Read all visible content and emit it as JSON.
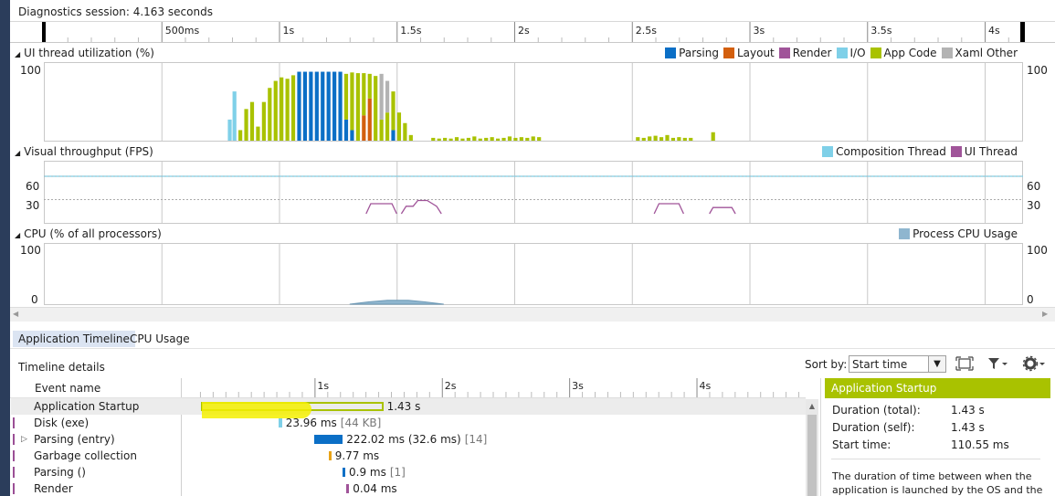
{
  "session": {
    "title": "Diagnostics session: 4.163 seconds"
  },
  "ruler": {
    "ticks": [
      "500ms",
      "1s",
      "1.5s",
      "2s",
      "2.5s",
      "3s",
      "3.5s",
      "4s"
    ]
  },
  "ui_thread": {
    "title": "UI thread utilization (%)",
    "y_label_top": "100",
    "legend": [
      {
        "label": "Parsing",
        "color": "#0b6fc6"
      },
      {
        "label": "Layout",
        "color": "#d35f0e"
      },
      {
        "label": "Render",
        "color": "#a05499"
      },
      {
        "label": "I/O",
        "color": "#7fd0e8"
      },
      {
        "label": "App Code",
        "color": "#a9c200"
      },
      {
        "label": "Xaml Other",
        "color": "#b3b3b3"
      }
    ]
  },
  "fps": {
    "title": "Visual throughput (FPS)",
    "y_labels": [
      "60",
      "30"
    ],
    "legend": [
      {
        "label": "Composition Thread",
        "color": "#7fd0e8"
      },
      {
        "label": "UI Thread",
        "color": "#a05499"
      }
    ]
  },
  "cpu": {
    "title": "CPU (% of all processors)",
    "y_labels": [
      "100",
      "0"
    ],
    "legend": [
      {
        "label": "Process CPU Usage",
        "color": "#8fb6cf"
      }
    ]
  },
  "tabs": [
    {
      "label": "Application Timeline",
      "active": true
    },
    {
      "label": "CPU Usage",
      "active": false
    }
  ],
  "details": {
    "title": "Timeline details",
    "sort_label": "Sort by:",
    "sort_value": "Start time",
    "col_event": "Event name",
    "ticks": [
      "1s",
      "2s",
      "3s",
      "4s"
    ],
    "events": [
      {
        "name": "Application Startup",
        "expandable": false,
        "duration": "1.43 s",
        "extra": "",
        "color": "#a9c200"
      },
      {
        "name": "Disk (exe)",
        "expandable": false,
        "duration": "23.96 ms",
        "extra": "[44 KB]",
        "color": "#7fd0e8"
      },
      {
        "name": "Parsing (entry)",
        "expandable": true,
        "duration": "222.02 ms (32.6 ms)",
        "extra": "[14]",
        "color": "#0b6fc6"
      },
      {
        "name": "Garbage collection",
        "expandable": false,
        "duration": "9.77 ms",
        "extra": "",
        "color": "#e8a317"
      },
      {
        "name": "Parsing ()",
        "expandable": false,
        "duration": "0.9 ms",
        "extra": "[1]",
        "color": "#0b6fc6"
      },
      {
        "name": "Render",
        "expandable": false,
        "duration": "0.04 ms",
        "extra": "",
        "color": "#a05499"
      }
    ]
  },
  "props": {
    "title": "Application Startup",
    "rows": [
      {
        "key": "Duration (total):",
        "value": "1.43 s"
      },
      {
        "key": "Duration (self):",
        "value": "1.43 s"
      },
      {
        "key": "Start time:",
        "value": "110.55 ms"
      }
    ],
    "description": "The duration of time between when the application is launched by the OS and the"
  },
  "chart_data": [
    {
      "type": "bar",
      "title": "UI thread utilization (%)",
      "x_unit": "s",
      "ylim": [
        0,
        100
      ],
      "legend_placement": "top-right",
      "series_order": [
        "Parsing",
        "Layout",
        "Render",
        "I/O",
        "App Code",
        "Xaml Other"
      ],
      "bars": [
        {
          "t": 0.79,
          "s": {
            "I/O": 30
          }
        },
        {
          "t": 0.81,
          "s": {
            "I/O": 70
          }
        },
        {
          "t": 0.835,
          "s": {
            "App Code": 15
          }
        },
        {
          "t": 0.86,
          "s": {
            "App Code": 45
          }
        },
        {
          "t": 0.885,
          "s": {
            "App Code": 55
          }
        },
        {
          "t": 0.91,
          "s": {
            "App Code": 20
          }
        },
        {
          "t": 0.935,
          "s": {
            "App Code": 55
          }
        },
        {
          "t": 0.96,
          "s": {
            "App Code": 75
          }
        },
        {
          "t": 0.985,
          "s": {
            "App Code": 85
          }
        },
        {
          "t": 1.01,
          "s": {
            "App Code": 90
          }
        },
        {
          "t": 1.035,
          "s": {
            "App Code": 88
          }
        },
        {
          "t": 1.06,
          "s": {
            "App Code": 93
          }
        },
        {
          "t": 1.085,
          "s": {
            "Parsing": 98
          }
        },
        {
          "t": 1.11,
          "s": {
            "Parsing": 98
          }
        },
        {
          "t": 1.135,
          "s": {
            "Parsing": 98
          }
        },
        {
          "t": 1.16,
          "s": {
            "Parsing": 98
          }
        },
        {
          "t": 1.185,
          "s": {
            "Parsing": 98
          }
        },
        {
          "t": 1.21,
          "s": {
            "Parsing": 98
          }
        },
        {
          "t": 1.235,
          "s": {
            "Parsing": 98
          }
        },
        {
          "t": 1.26,
          "s": {
            "Parsing": 98
          }
        },
        {
          "t": 1.285,
          "s": {
            "App Code": 65,
            "Parsing": 30
          }
        },
        {
          "t": 1.31,
          "s": {
            "App Code": 82,
            "Parsing": 15
          }
        },
        {
          "t": 1.335,
          "s": {
            "App Code": 96
          }
        },
        {
          "t": 1.36,
          "s": {
            "App Code": 60,
            "Layout": 36
          }
        },
        {
          "t": 1.385,
          "s": {
            "App Code": 35,
            "Layout": 60
          }
        },
        {
          "t": 1.41,
          "s": {
            "App Code": 92
          }
        },
        {
          "t": 1.435,
          "s": {
            "App Code": 30,
            "Xaml Other": 65
          }
        },
        {
          "t": 1.46,
          "s": {
            "App Code": 40,
            "Xaml Other": 45
          }
        },
        {
          "t": 1.485,
          "s": {
            "App Code": 55,
            "Parsing": 15
          }
        },
        {
          "t": 1.51,
          "s": {
            "App Code": 40
          }
        },
        {
          "t": 1.535,
          "s": {
            "App Code": 25
          }
        },
        {
          "t": 1.56,
          "s": {
            "App Code": 8
          }
        },
        {
          "t": 1.655,
          "s": {
            "App Code": 4
          }
        },
        {
          "t": 1.68,
          "s": {
            "App Code": 3
          }
        },
        {
          "t": 1.705,
          "s": {
            "App Code": 4
          }
        },
        {
          "t": 1.73,
          "s": {
            "App Code": 3
          }
        },
        {
          "t": 1.755,
          "s": {
            "App Code": 5
          }
        },
        {
          "t": 1.78,
          "s": {
            "App Code": 3
          }
        },
        {
          "t": 1.805,
          "s": {
            "App Code": 4
          }
        },
        {
          "t": 1.83,
          "s": {
            "App Code": 6
          }
        },
        {
          "t": 1.855,
          "s": {
            "App Code": 3
          }
        },
        {
          "t": 1.88,
          "s": {
            "App Code": 4
          }
        },
        {
          "t": 1.905,
          "s": {
            "App Code": 5
          }
        },
        {
          "t": 1.93,
          "s": {
            "App Code": 3
          }
        },
        {
          "t": 1.955,
          "s": {
            "App Code": 4
          }
        },
        {
          "t": 1.98,
          "s": {
            "App Code": 6
          }
        },
        {
          "t": 2.005,
          "s": {
            "App Code": 4
          }
        },
        {
          "t": 2.03,
          "s": {
            "App Code": 5
          }
        },
        {
          "t": 2.055,
          "s": {
            "App Code": 4
          }
        },
        {
          "t": 2.08,
          "s": {
            "App Code": 6
          }
        },
        {
          "t": 2.105,
          "s": {
            "App Code": 5
          }
        },
        {
          "t": 2.525,
          "s": {
            "App Code": 5
          }
        },
        {
          "t": 2.55,
          "s": {
            "App Code": 4
          }
        },
        {
          "t": 2.575,
          "s": {
            "App Code": 6
          }
        },
        {
          "t": 2.6,
          "s": {
            "App Code": 7
          }
        },
        {
          "t": 2.625,
          "s": {
            "App Code": 5
          }
        },
        {
          "t": 2.65,
          "s": {
            "App Code": 8
          }
        },
        {
          "t": 2.675,
          "s": {
            "App Code": 4
          }
        },
        {
          "t": 2.7,
          "s": {
            "App Code": 5
          }
        },
        {
          "t": 2.725,
          "s": {
            "App Code": 4
          }
        },
        {
          "t": 2.75,
          "s": {
            "App Code": 4
          }
        },
        {
          "t": 2.845,
          "s": {
            "App Code": 12
          }
        }
      ]
    },
    {
      "type": "line",
      "title": "Visual throughput (FPS)",
      "x_unit": "s",
      "ylim": [
        0,
        80
      ],
      "legend_placement": "top-right",
      "series": [
        {
          "name": "Composition Thread",
          "constant": 60
        },
        {
          "name": "UI Thread",
          "segments": [
            [
              [
                1.37,
                0
              ],
              [
                1.39,
                10
              ],
              [
                1.48,
                10
              ],
              [
                1.5,
                0
              ]
            ],
            [
              [
                1.52,
                0
              ],
              [
                1.54,
                6
              ],
              [
                1.57,
                6
              ],
              [
                1.59,
                15
              ],
              [
                1.63,
                15
              ],
              [
                1.67,
                6
              ],
              [
                1.69,
                0
              ]
            ],
            [
              [
                2.595,
                0
              ],
              [
                2.615,
                10
              ],
              [
                2.7,
                10
              ],
              [
                2.72,
                0
              ]
            ],
            [
              [
                2.83,
                0
              ],
              [
                2.845,
                4
              ],
              [
                2.925,
                4
              ],
              [
                2.94,
                0
              ]
            ]
          ]
        }
      ]
    },
    {
      "type": "area",
      "title": "CPU (% of all processors)",
      "x_unit": "s",
      "ylim": [
        0,
        100
      ],
      "legend_placement": "top-right",
      "series": [
        {
          "name": "Process CPU Usage",
          "points": [
            [
              1.3,
              0
            ],
            [
              1.38,
              3
            ],
            [
              1.46,
              5
            ],
            [
              1.55,
              5
            ],
            [
              1.62,
              3
            ],
            [
              1.7,
              0
            ]
          ]
        }
      ]
    }
  ]
}
